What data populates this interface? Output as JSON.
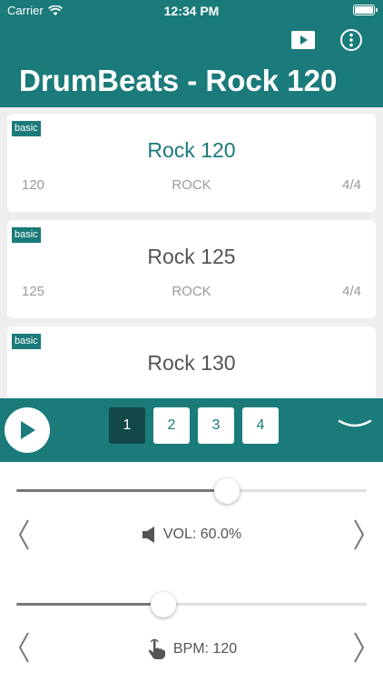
{
  "status_bar": {
    "carrier": "Carrier",
    "time": "12:34 PM"
  },
  "nav": {
    "title": "DrumBeats - Rock 120",
    "accent": "#1b7a7a"
  },
  "beats": [
    {
      "badge": "basic",
      "name": "Rock 120",
      "bpm": "120",
      "genre": "ROCK",
      "signature": "4/4",
      "selected": true
    },
    {
      "badge": "basic",
      "name": "Rock 125",
      "bpm": "125",
      "genre": "ROCK",
      "signature": "4/4",
      "selected": false
    },
    {
      "badge": "basic",
      "name": "Rock 130",
      "bpm": "",
      "genre": "",
      "signature": "",
      "selected": false
    }
  ],
  "player": {
    "bars": [
      "1",
      "2",
      "3",
      "4"
    ],
    "active_bar": "1"
  },
  "volume": {
    "label": "VOL: 60.0%",
    "value": 0.6,
    "icon": "speaker-icon"
  },
  "bpm": {
    "label": "BPM: 120",
    "value": 0.42,
    "icon": "tap-hand-icon"
  }
}
